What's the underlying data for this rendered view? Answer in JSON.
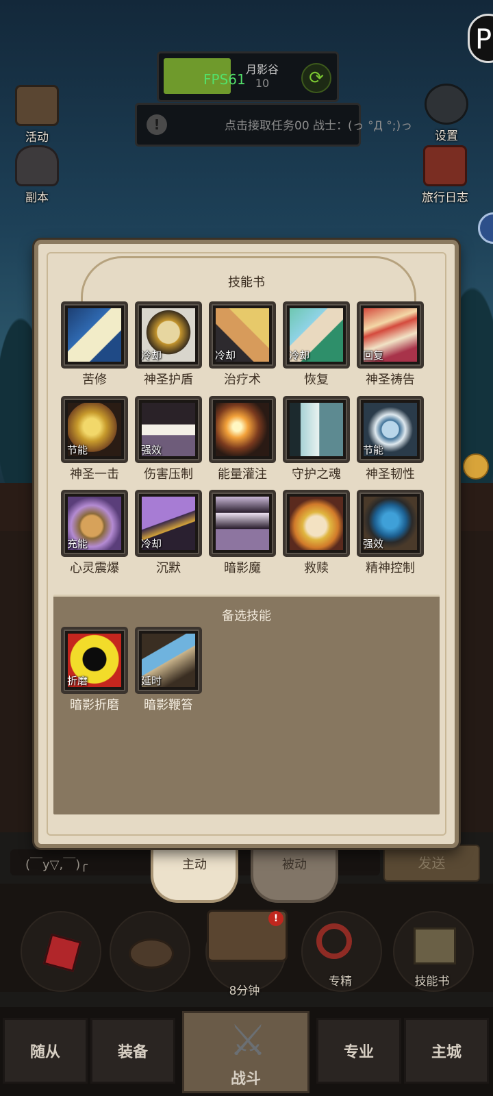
{
  "hud": {
    "zone_name": "月影谷",
    "zone_sub": "10",
    "fps": "FPS61",
    "notice": "点击接取任务00 战士：(っ °Д °;)っ"
  },
  "side_icons": {
    "activity": "活动",
    "dungeon": "副本",
    "settings": "设置",
    "travel_log": "旅行日志"
  },
  "panel": {
    "title": "技能书",
    "alt_title": "备选技能",
    "skills": [
      {
        "name": "苦修",
        "tag": ""
      },
      {
        "name": "神圣护盾",
        "tag": "冷却"
      },
      {
        "name": "治疗术",
        "tag": "冷却"
      },
      {
        "name": "恢复",
        "tag": "冷却"
      },
      {
        "name": "神圣祷告",
        "tag": "回复"
      },
      {
        "name": "神圣一击",
        "tag": "节能"
      },
      {
        "name": "伤害压制",
        "tag": "强效"
      },
      {
        "name": "能量灌注",
        "tag": ""
      },
      {
        "name": "守护之魂",
        "tag": ""
      },
      {
        "name": "神圣韧性",
        "tag": "节能"
      },
      {
        "name": "心灵震爆",
        "tag": "充能"
      },
      {
        "name": "沉默",
        "tag": "冷却"
      },
      {
        "name": "暗影魔",
        "tag": ""
      },
      {
        "name": "救赎",
        "tag": ""
      },
      {
        "name": "精神控制",
        "tag": "强效"
      }
    ],
    "alt_skills": [
      {
        "name": "暗影折磨",
        "tag": "折磨"
      },
      {
        "name": "暗影鞭笞",
        "tag": "延时"
      }
    ]
  },
  "tabs": {
    "active": "主动",
    "passive": "被动"
  },
  "chat": {
    "text": "(￣y▽,￣)╭",
    "send": "发送"
  },
  "actions": {
    "chest_timer": "8分钟",
    "specialization": "专精",
    "skill_book": "技能书"
  },
  "nav": {
    "followers": "随从",
    "equipment": "装备",
    "battle": "战斗",
    "profession": "专业",
    "main_city": "主城"
  }
}
